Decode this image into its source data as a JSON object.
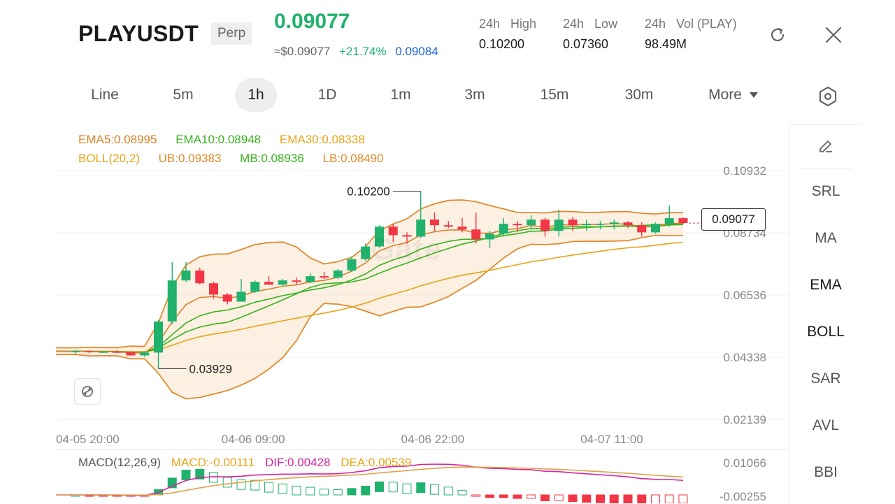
{
  "header": {
    "symbol": "PLAYUSDT",
    "contract_type": "Perp",
    "last_price": "0.09077",
    "usd_price": "≈$0.09077",
    "change": "+21.74%",
    "mark_price": "0.09084",
    "stats": [
      {
        "label": "24h   High",
        "value": "0.10200"
      },
      {
        "label": "24h   Low",
        "value": "0.07360"
      },
      {
        "label": "24h   Vol (PLAY)",
        "value": "98.49M"
      }
    ],
    "refresh_icon": "refresh-icon",
    "close_icon": "close-icon"
  },
  "tabs": {
    "items": [
      "Line",
      "5m",
      "1h",
      "1D",
      "1m",
      "3m",
      "15m",
      "30m",
      "More"
    ],
    "active": "1h",
    "settings_icon": "hexagon-settings-icon"
  },
  "sidebar": {
    "draw_icon": "pencil-icon",
    "items": [
      "SRL",
      "MA",
      "EMA",
      "BOLL",
      "SAR",
      "AVL",
      "BBI"
    ],
    "active": [
      "EMA",
      "BOLL"
    ]
  },
  "legend": {
    "ema5": "EMA5:0.08995",
    "ema10": "EMA10:0.08948",
    "ema30": "EMA30:0.08338",
    "boll": "BOLL(20,2)",
    "ub": "UB:0.09383",
    "mb": "MB:0.08936",
    "lb": "LB:0.08490"
  },
  "macd_legend": {
    "name": "MACD(12,26,9)",
    "macd": "MACD:-0.00111",
    "dif": "DIF:0.00428",
    "dea": "DEA:0.00539"
  },
  "watermark": "Gate",
  "current_price_label": "0.09077",
  "colors": {
    "up": "#20b26c",
    "down": "#f23645",
    "ema5": "#d9822b",
    "ema10": "#37b21d",
    "ema30": "#e8a317",
    "boll_band": "#e08a2c",
    "boll_mid": "#37b21d",
    "dif": "#d6249f",
    "dea": "#e2a04a"
  },
  "chart_data": {
    "type": "candlestick",
    "interval": "1h",
    "x_ticks": [
      "04-05 20:00",
      "04-06 09:00",
      "04-06 22:00",
      "04-07 11:00"
    ],
    "y_ticks": [
      "0.10932",
      "0.08734",
      "0.06536",
      "0.04338",
      "0.02139"
    ],
    "y_range": [
      0.02139,
      0.10932
    ],
    "annotations": {
      "high": "0.10200",
      "low": "0.03929"
    },
    "candles": [
      [
        0.0455,
        0.046,
        0.0445,
        0.0455
      ],
      [
        0.0455,
        0.0458,
        0.0448,
        0.0452
      ],
      [
        0.0452,
        0.0456,
        0.0448,
        0.0453
      ],
      [
        0.0453,
        0.0458,
        0.0449,
        0.0452
      ],
      [
        0.0452,
        0.0455,
        0.044,
        0.044
      ],
      [
        0.044,
        0.0452,
        0.0436,
        0.045
      ],
      [
        0.045,
        0.0565,
        0.0393,
        0.056
      ],
      [
        0.056,
        0.077,
        0.055,
        0.0705
      ],
      [
        0.0705,
        0.077,
        0.07,
        0.074
      ],
      [
        0.074,
        0.075,
        0.069,
        0.0695
      ],
      [
        0.0695,
        0.07,
        0.064,
        0.0655
      ],
      [
        0.0655,
        0.066,
        0.062,
        0.063
      ],
      [
        0.063,
        0.071,
        0.063,
        0.0665
      ],
      [
        0.0665,
        0.0705,
        0.066,
        0.07
      ],
      [
        0.07,
        0.072,
        0.069,
        0.069
      ],
      [
        0.069,
        0.071,
        0.0685,
        0.0705
      ],
      [
        0.0705,
        0.0715,
        0.069,
        0.07
      ],
      [
        0.07,
        0.073,
        0.0695,
        0.072
      ],
      [
        0.072,
        0.0735,
        0.071,
        0.0715
      ],
      [
        0.0715,
        0.0745,
        0.071,
        0.074
      ],
      [
        0.074,
        0.079,
        0.0735,
        0.078
      ],
      [
        0.078,
        0.0835,
        0.0775,
        0.0825
      ],
      [
        0.0825,
        0.09,
        0.082,
        0.0895
      ],
      [
        0.0895,
        0.0905,
        0.084,
        0.0865
      ],
      [
        0.0865,
        0.0875,
        0.0835,
        0.086
      ],
      [
        0.086,
        0.102,
        0.0855,
        0.092
      ],
      [
        0.092,
        0.0945,
        0.088,
        0.09
      ],
      [
        0.09,
        0.0915,
        0.089,
        0.0895
      ],
      [
        0.0895,
        0.0925,
        0.0875,
        0.0885
      ],
      [
        0.0885,
        0.0945,
        0.0835,
        0.085
      ],
      [
        0.085,
        0.088,
        0.082,
        0.087
      ],
      [
        0.087,
        0.0925,
        0.086,
        0.0905
      ],
      [
        0.0905,
        0.0915,
        0.0875,
        0.09
      ],
      [
        0.09,
        0.0935,
        0.0885,
        0.092
      ],
      [
        0.092,
        0.0925,
        0.086,
        0.088
      ],
      [
        0.088,
        0.0955,
        0.086,
        0.092
      ],
      [
        0.092,
        0.093,
        0.088,
        0.09
      ],
      [
        0.09,
        0.092,
        0.088,
        0.0905
      ],
      [
        0.0905,
        0.0915,
        0.0885,
        0.0905
      ],
      [
        0.0905,
        0.092,
        0.0885,
        0.091
      ],
      [
        0.091,
        0.0915,
        0.089,
        0.09
      ],
      [
        0.09,
        0.091,
        0.086,
        0.0875
      ],
      [
        0.0875,
        0.091,
        0.087,
        0.0905
      ],
      [
        0.0905,
        0.097,
        0.0895,
        0.0925
      ],
      [
        0.0925,
        0.0928,
        0.0905,
        0.0908
      ]
    ],
    "macd": {
      "dif_last": 0.00428,
      "dea_last": 0.00539,
      "hist_last": -0.00111,
      "y_ticks": [
        "0.01066",
        "-0.00255"
      ]
    }
  }
}
